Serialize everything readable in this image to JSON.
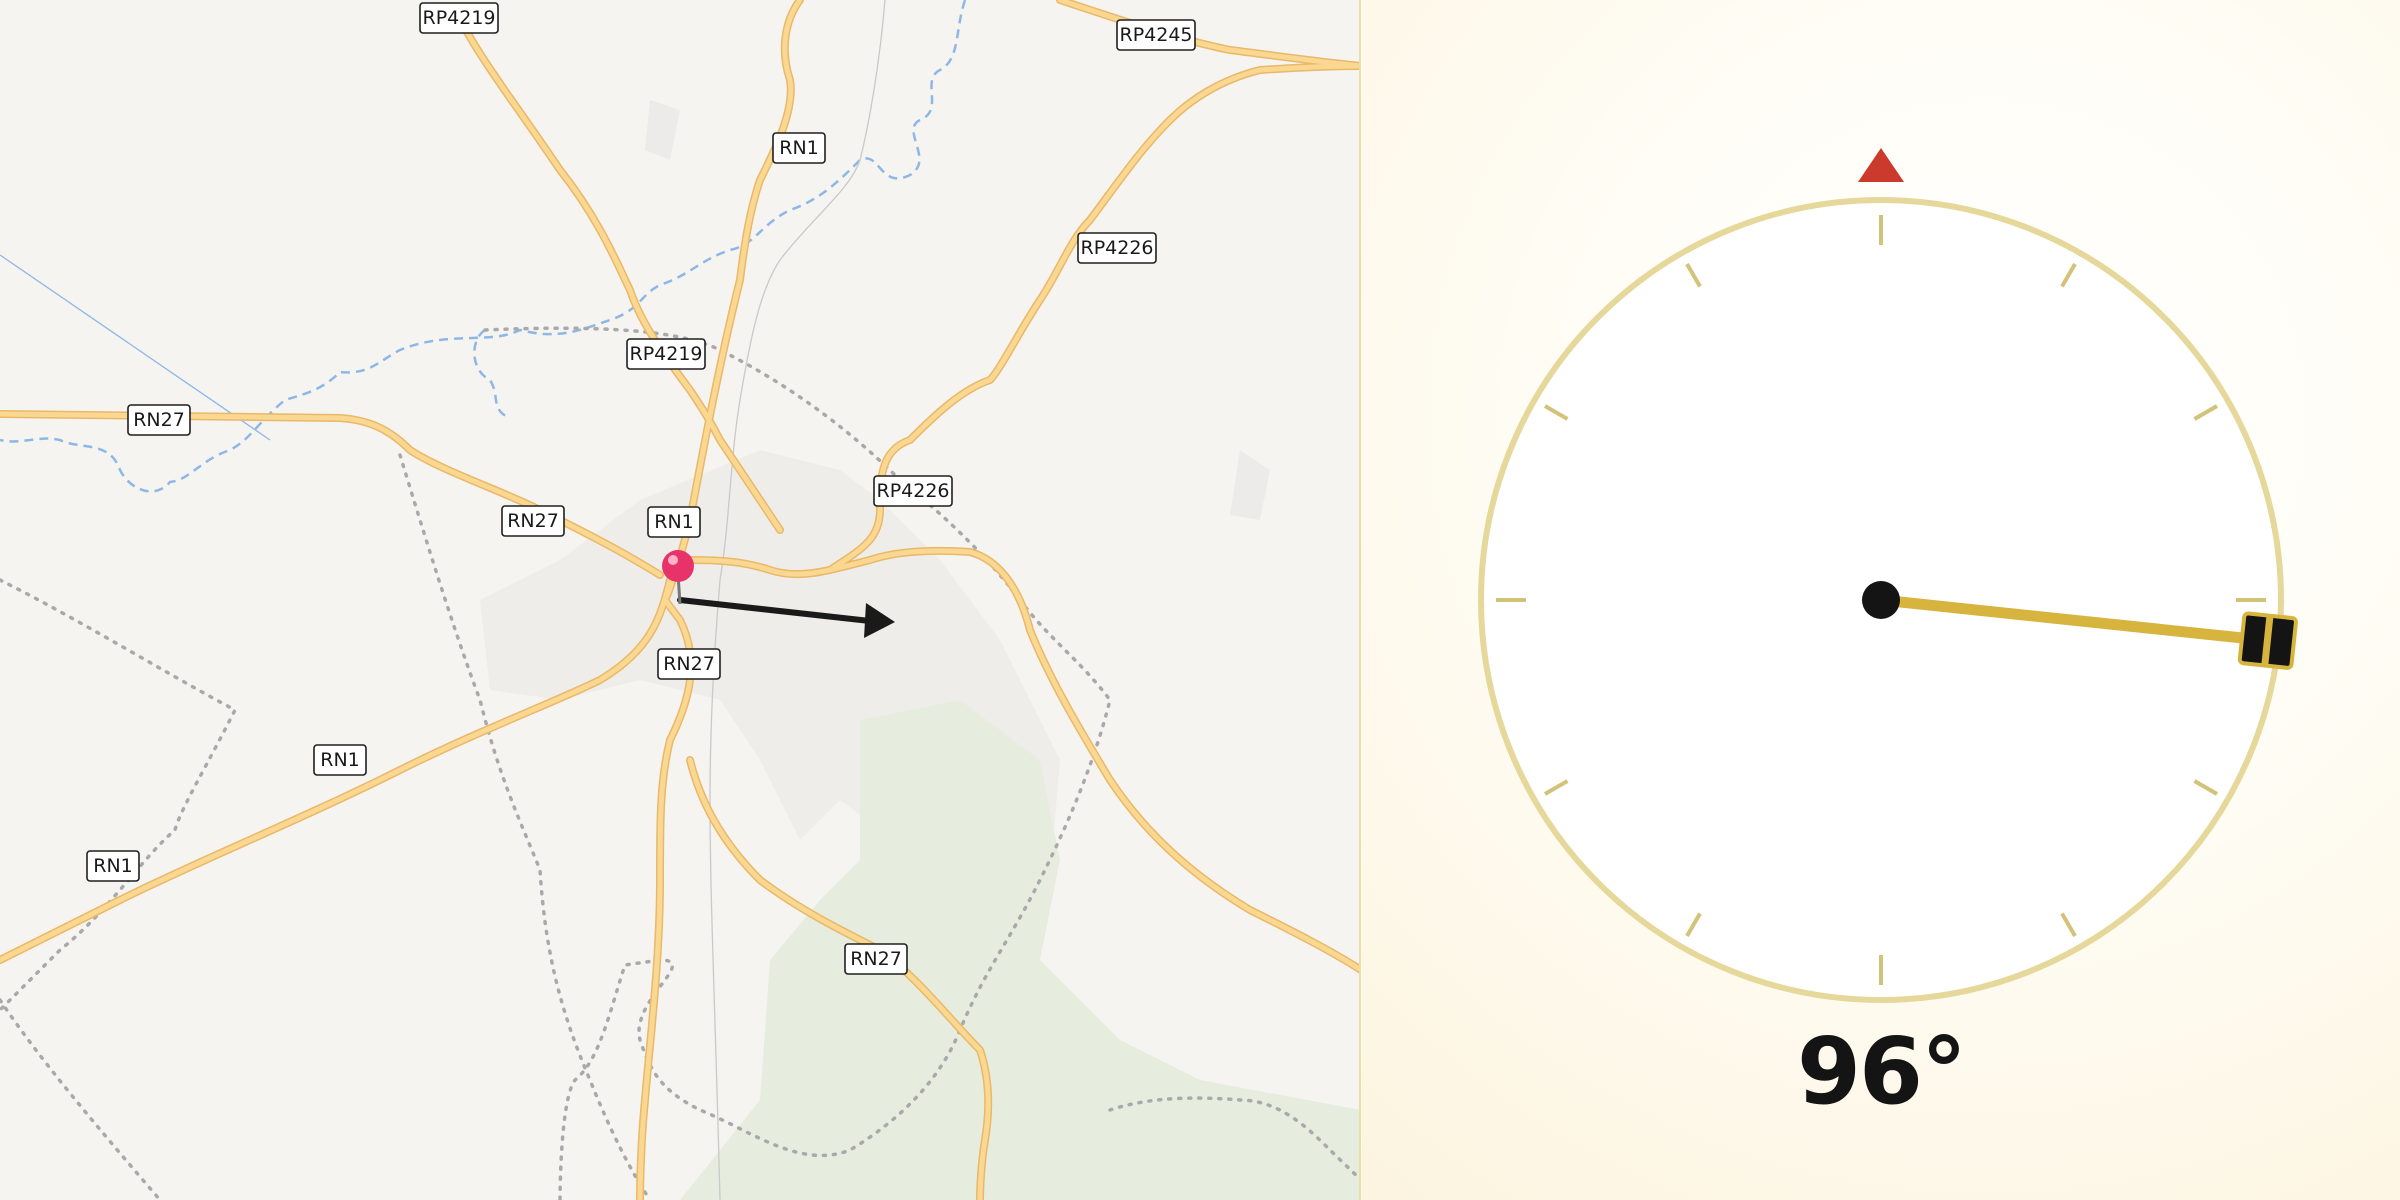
{
  "map": {
    "road_labels": [
      {
        "text": "RP4219"
      },
      {
        "text": "RP4245"
      },
      {
        "text": "RN1"
      },
      {
        "text": "RP4226"
      },
      {
        "text": "RP4219"
      },
      {
        "text": "RN27"
      },
      {
        "text": "RN27"
      },
      {
        "text": "RN1"
      },
      {
        "text": "RP4226"
      },
      {
        "text": "RN27"
      },
      {
        "text": "RN1"
      },
      {
        "text": "RN1"
      },
      {
        "text": "RN27"
      }
    ],
    "pin_icon": "location-pin-icon",
    "arrow_icon": "direction-arrow-icon",
    "colors": {
      "road": "#f8cf7a",
      "water": "#8db7e6",
      "boundary": "#a9a9ac",
      "forest": "#e6eddf",
      "pin": "#e8336a"
    }
  },
  "compass": {
    "heading_degrees": 96,
    "heading_text": "96°",
    "north_marker_icon": "north-triangle-icon",
    "needle_icon": "compass-needle-icon",
    "colors": {
      "ring": "#e5d89a",
      "needle": "#d6b43e",
      "north": "#cc3a2b",
      "hub": "#141414"
    }
  }
}
